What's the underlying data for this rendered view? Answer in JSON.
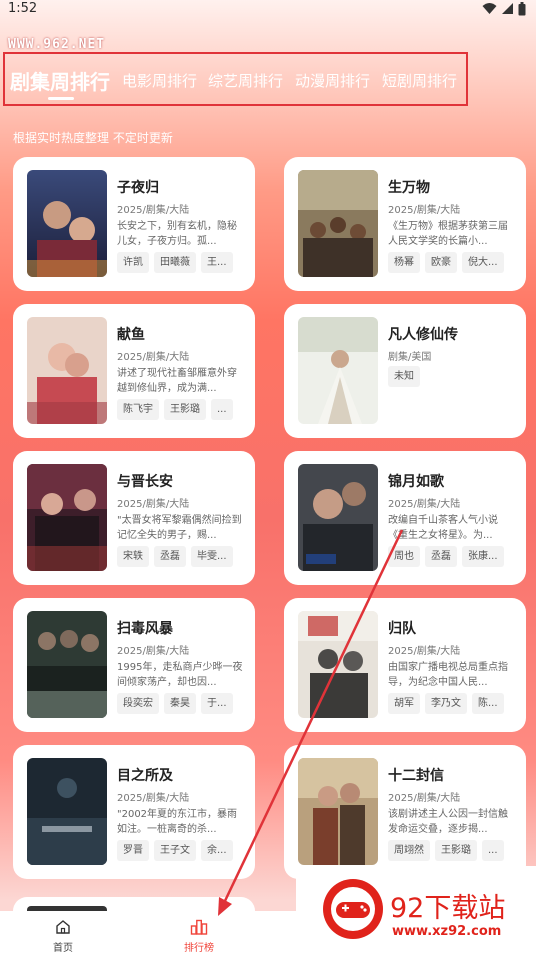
{
  "status": {
    "time": "1:52"
  },
  "watermark": "WWW.962.NET",
  "tabs": [
    {
      "label": "剧集周排行"
    },
    {
      "label": "电影周排行"
    },
    {
      "label": "综艺周排行"
    },
    {
      "label": "动漫周排行"
    },
    {
      "label": "短剧周排行"
    }
  ],
  "subtitle": "根据实时热度整理 不定时更新",
  "cards": [
    {
      "title": "子夜归",
      "meta": "2025/剧集/大陆",
      "desc": "长安之下，别有玄机，隐秘儿女，子夜方归。孤...",
      "tags": [
        "许凯",
        "田曦薇",
        "王..."
      ]
    },
    {
      "title": "生万物",
      "meta": "2025/剧集/大陆",
      "desc": "《生万物》根据茅获第三届人民文学奖的长篇小...",
      "tags": [
        "杨幂",
        "欧豪",
        "倪大..."
      ]
    },
    {
      "title": "献鱼",
      "meta": "2025/剧集/大陆",
      "desc": "讲述了现代社畜邹雁意外穿越到修仙界，成为满...",
      "tags": [
        "陈飞宇",
        "王影璐",
        "..."
      ]
    },
    {
      "title": "凡人修仙传",
      "meta": "剧集/美国",
      "desc": "",
      "tags": [
        "未知"
      ]
    },
    {
      "title": "与晋长安",
      "meta": "2025/剧集/大陆",
      "desc": "\"太晋女将军黎霜偶然间捡到记忆全失的男子，赐...",
      "tags": [
        "宋轶",
        "丞磊",
        "毕雯..."
      ]
    },
    {
      "title": "锦月如歌",
      "meta": "2025/剧集/大陆",
      "desc": "改编自千山茶客人气小说《重生之女将星》。为...",
      "tags": [
        "周也",
        "丞磊",
        "张康..."
      ]
    },
    {
      "title": "扫毒风暴",
      "meta": "2025/剧集/大陆",
      "desc": "1995年，走私商卢少晔一夜间倾家荡产，却也因...",
      "tags": [
        "段奕宏",
        "秦昊",
        "于..."
      ]
    },
    {
      "title": "归队",
      "meta": "2025/剧集/大陆",
      "desc": "由国家广播电视总局重点指导，为纪念中国人民...",
      "tags": [
        "胡军",
        "李乃文",
        "陈..."
      ]
    },
    {
      "title": "目之所及",
      "meta": "2025/剧集/大陆",
      "desc": "\"2002年夏的东江市，暴雨如注。一桩离奇的杀...",
      "tags": [
        "罗晋",
        "王子文",
        "余..."
      ]
    },
    {
      "title": "十二封信",
      "meta": "2025/剧集/大陆",
      "desc": "该剧讲述主人公因一封信触发命运交叠，逐步揭...",
      "tags": [
        "周翊然",
        "王影璐",
        "..."
      ]
    }
  ],
  "nav": [
    {
      "label": "首页",
      "icon": "home-icon"
    },
    {
      "label": "排行榜",
      "icon": "ranking-icon"
    }
  ],
  "logo": {
    "name": "92下载站",
    "url": "www.xz92.com"
  },
  "colors": {
    "accent": "#f0443a",
    "annotation": "#e03339"
  }
}
